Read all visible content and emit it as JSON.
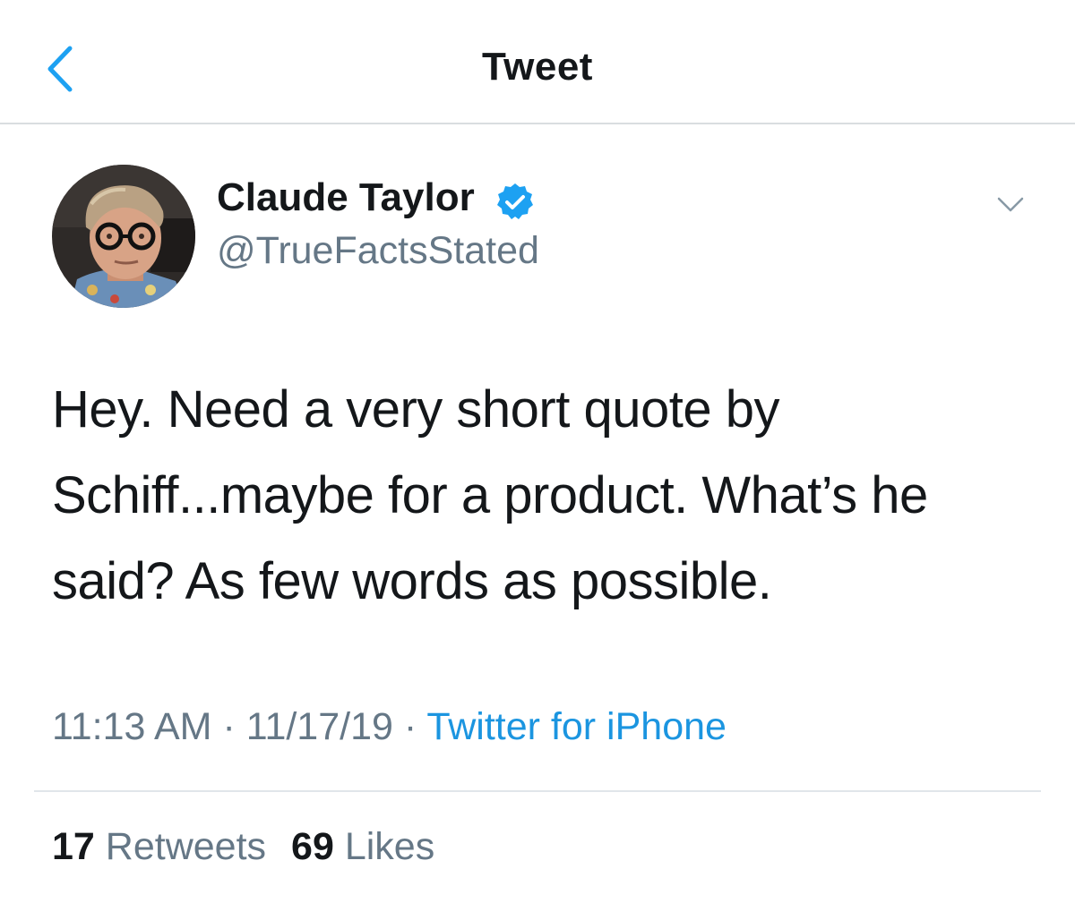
{
  "header": {
    "title": "Tweet"
  },
  "author": {
    "name": "Claude Taylor",
    "handle": "@TrueFactsStated",
    "verified": true
  },
  "tweet": {
    "text_lines": [
      "Hey. Need a very short quote by",
      "Schiff...maybe for a product. What’s he",
      "said? As few words as possible."
    ]
  },
  "meta": {
    "time": "11:13 AM",
    "separator1": " · ",
    "date": "11/17/19",
    "separator2": " · ",
    "source": "Twitter for iPhone"
  },
  "stats": {
    "retweets_count": "17",
    "retweets_label": "Retweets",
    "likes_count": "69",
    "likes_label": "Likes"
  },
  "colors": {
    "accent": "#1da1f2",
    "link": "#1b95e0",
    "secondary_text": "#657786",
    "primary_text": "#14171a",
    "divider": "#e1e6ea"
  },
  "icons": {
    "back": "chevron-left-icon",
    "verified": "verified-badge-icon",
    "menu": "chevron-down-icon"
  }
}
